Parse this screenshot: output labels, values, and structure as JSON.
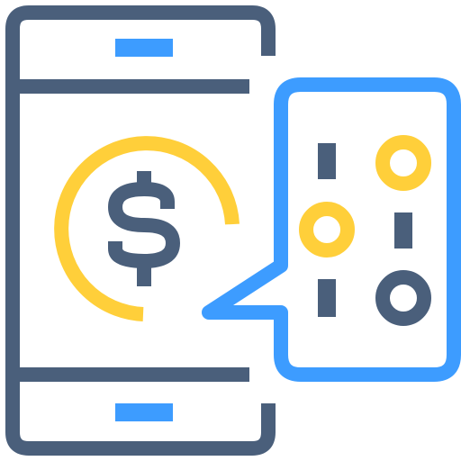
{
  "illustration": {
    "icon": "mobile-payment-bitcoin-icon",
    "colors": {
      "outline": "#4a5f7b",
      "accent_blue": "#3d9cff",
      "accent_yellow": "#ffcf3a",
      "background": "#ffffff"
    }
  }
}
